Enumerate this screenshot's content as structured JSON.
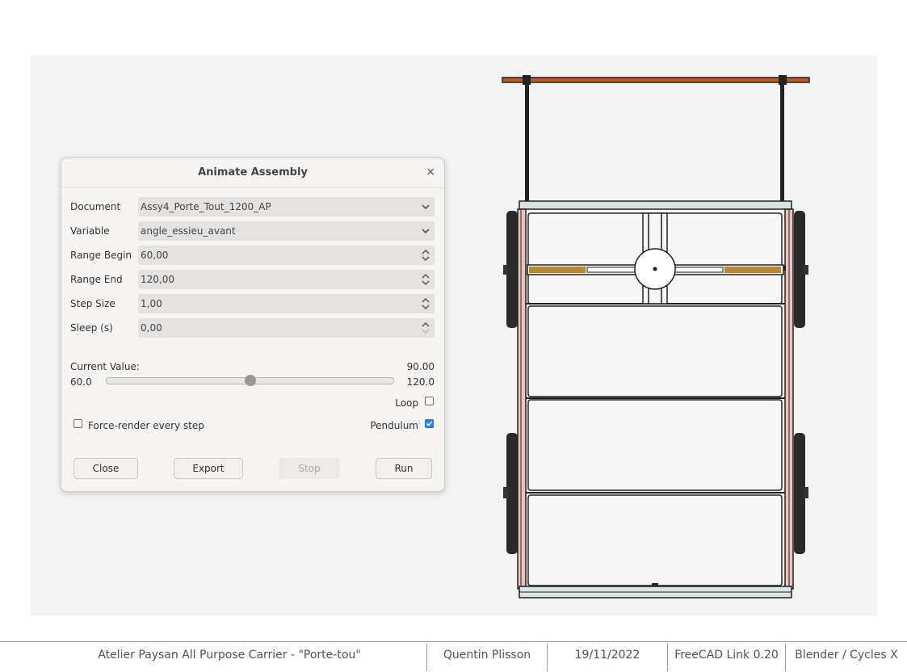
{
  "dialog": {
    "title": "Animate Assembly",
    "close_icon": "×",
    "fields": {
      "document": {
        "label": "Document",
        "value": "Assy4_Porte_Tout_1200_AP"
      },
      "variable": {
        "label": "Variable",
        "value": "angle_essieu_avant"
      },
      "range_begin": {
        "label": "Range Begin",
        "value": "60,00"
      },
      "range_end": {
        "label": "Range End",
        "value": "120,00"
      },
      "step_size": {
        "label": "Step Size",
        "value": "1,00"
      },
      "sleep": {
        "label": "Sleep (s)",
        "value": "0,00"
      }
    },
    "current_value_label": "Current Value:",
    "current_value": "90.00",
    "slider": {
      "min_label": "60.0",
      "max_label": "120.0",
      "min": 60,
      "max": 120,
      "value": 90
    },
    "loop_label": "Loop",
    "loop_checked": false,
    "force_render_label": "Force-render every step",
    "force_render_checked": false,
    "pendulum_label": "Pendulum",
    "pendulum_checked": true,
    "buttons": {
      "close": "Close",
      "export": "Export",
      "stop": "Stop",
      "run": "Run"
    }
  },
  "footer": {
    "project": "Atelier Paysan All Purpose Carrier - \"Porte-tou\"",
    "author": "Quentin Plisson",
    "date": "19/11/2022",
    "software": "FreeCAD Link 0.20",
    "renderer": "Blender / Cycles X"
  },
  "colors": {
    "viewport_bg": "#f4f4f4",
    "handle_bar": "#c0592a",
    "frame_side": "#e9c3bd",
    "axle_wood": "#b48a3a",
    "accent": "#3584e4"
  }
}
